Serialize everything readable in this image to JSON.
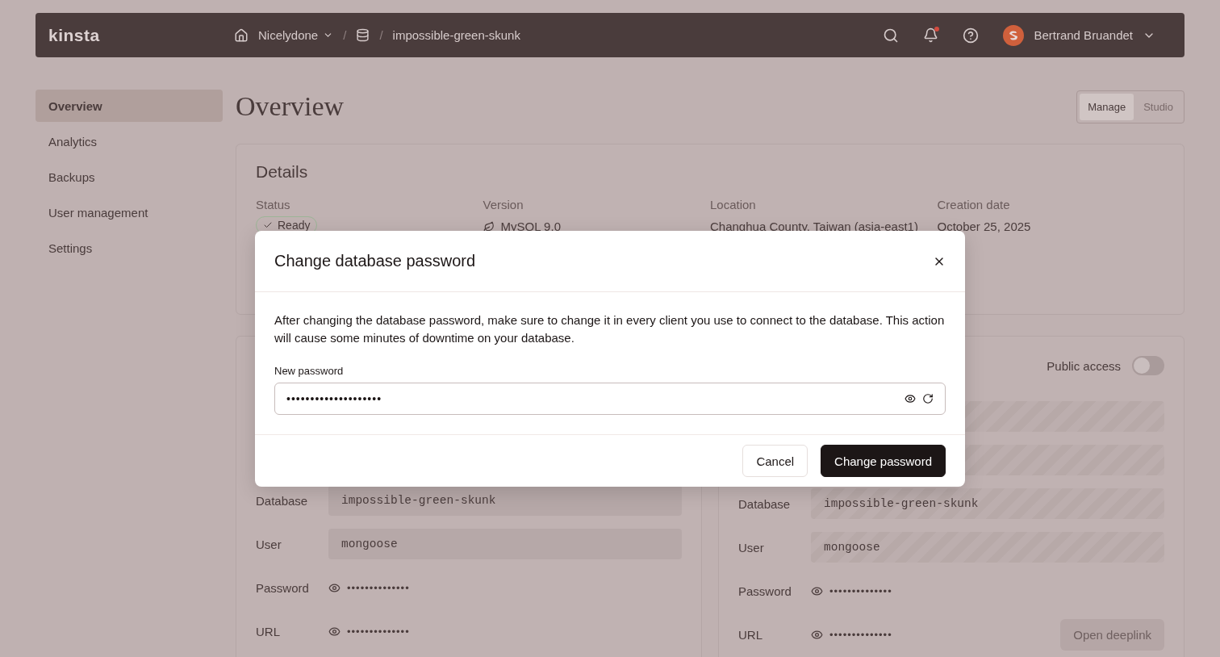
{
  "header": {
    "logo": "kinsta",
    "breadcrumbs": [
      {
        "kind": "home"
      },
      {
        "kind": "dropdown",
        "label": "Nicelydone"
      },
      {
        "kind": "separator",
        "label": "/"
      },
      {
        "kind": "database"
      },
      {
        "kind": "separator",
        "label": "/"
      },
      {
        "kind": "text",
        "label": "impossible-green-skunk"
      }
    ],
    "notifications_unread": true,
    "user": {
      "name": "Bertrand Bruandet"
    }
  },
  "sidebar": {
    "items": [
      {
        "label": "Overview",
        "selected": true
      },
      {
        "label": "Analytics",
        "selected": false
      },
      {
        "label": "Backups",
        "selected": false
      },
      {
        "label": "User management",
        "selected": false
      },
      {
        "label": "Settings",
        "selected": false
      }
    ]
  },
  "page_title": "Overview",
  "view_switch": [
    {
      "label": "Manage",
      "selected": true
    },
    {
      "label": "Studio",
      "selected": false
    }
  ],
  "details": {
    "title": "Details",
    "fields": [
      {
        "kind": "status",
        "label": "Status",
        "value": "Ready"
      },
      {
        "kind": "version",
        "label": "Version",
        "value": "MySQL 9.0"
      },
      {
        "kind": "text",
        "label": "Location",
        "value": "Changhua County, Taiwan (asia-east1)"
      },
      {
        "kind": "text",
        "label": "Creation date",
        "value": "October 25, 2025"
      }
    ]
  },
  "internal_connection": {
    "rows": [
      {
        "kind": "field",
        "label": "Database",
        "value": "impossible-green-skunk"
      },
      {
        "kind": "field",
        "label": "User",
        "value": "mongoose"
      },
      {
        "kind": "secret",
        "label": "Password",
        "value": "••••••••••••••"
      },
      {
        "kind": "secret",
        "label": "URL",
        "value": "••••••••••••••"
      }
    ]
  },
  "external_connection": {
    "public_access": {
      "label": "Public access",
      "on": false
    },
    "rows": [
      {
        "kind": "blank"
      },
      {
        "kind": "blank"
      },
      {
        "kind": "field",
        "label": "Database",
        "value": "impossible-green-skunk"
      },
      {
        "kind": "field",
        "label": "User",
        "value": "mongoose"
      },
      {
        "kind": "secret",
        "label": "Password",
        "value": "••••••••••••••"
      },
      {
        "kind": "secret",
        "label": "URL",
        "value": "••••••••••••••"
      }
    ],
    "button": {
      "label": "Open deeplink",
      "disabled": true
    }
  },
  "modal": {
    "title": "Change database password",
    "body": "After changing the database password, make sure to change it in every client you use to connect to the database. This action will cause some minutes of downtime on your database.",
    "field_label": "New password",
    "field_value": "••••••••••••••••••••",
    "buttons": [
      {
        "kind": "secondary",
        "label": "Cancel"
      },
      {
        "kind": "primary",
        "label": "Change password"
      }
    ]
  }
}
